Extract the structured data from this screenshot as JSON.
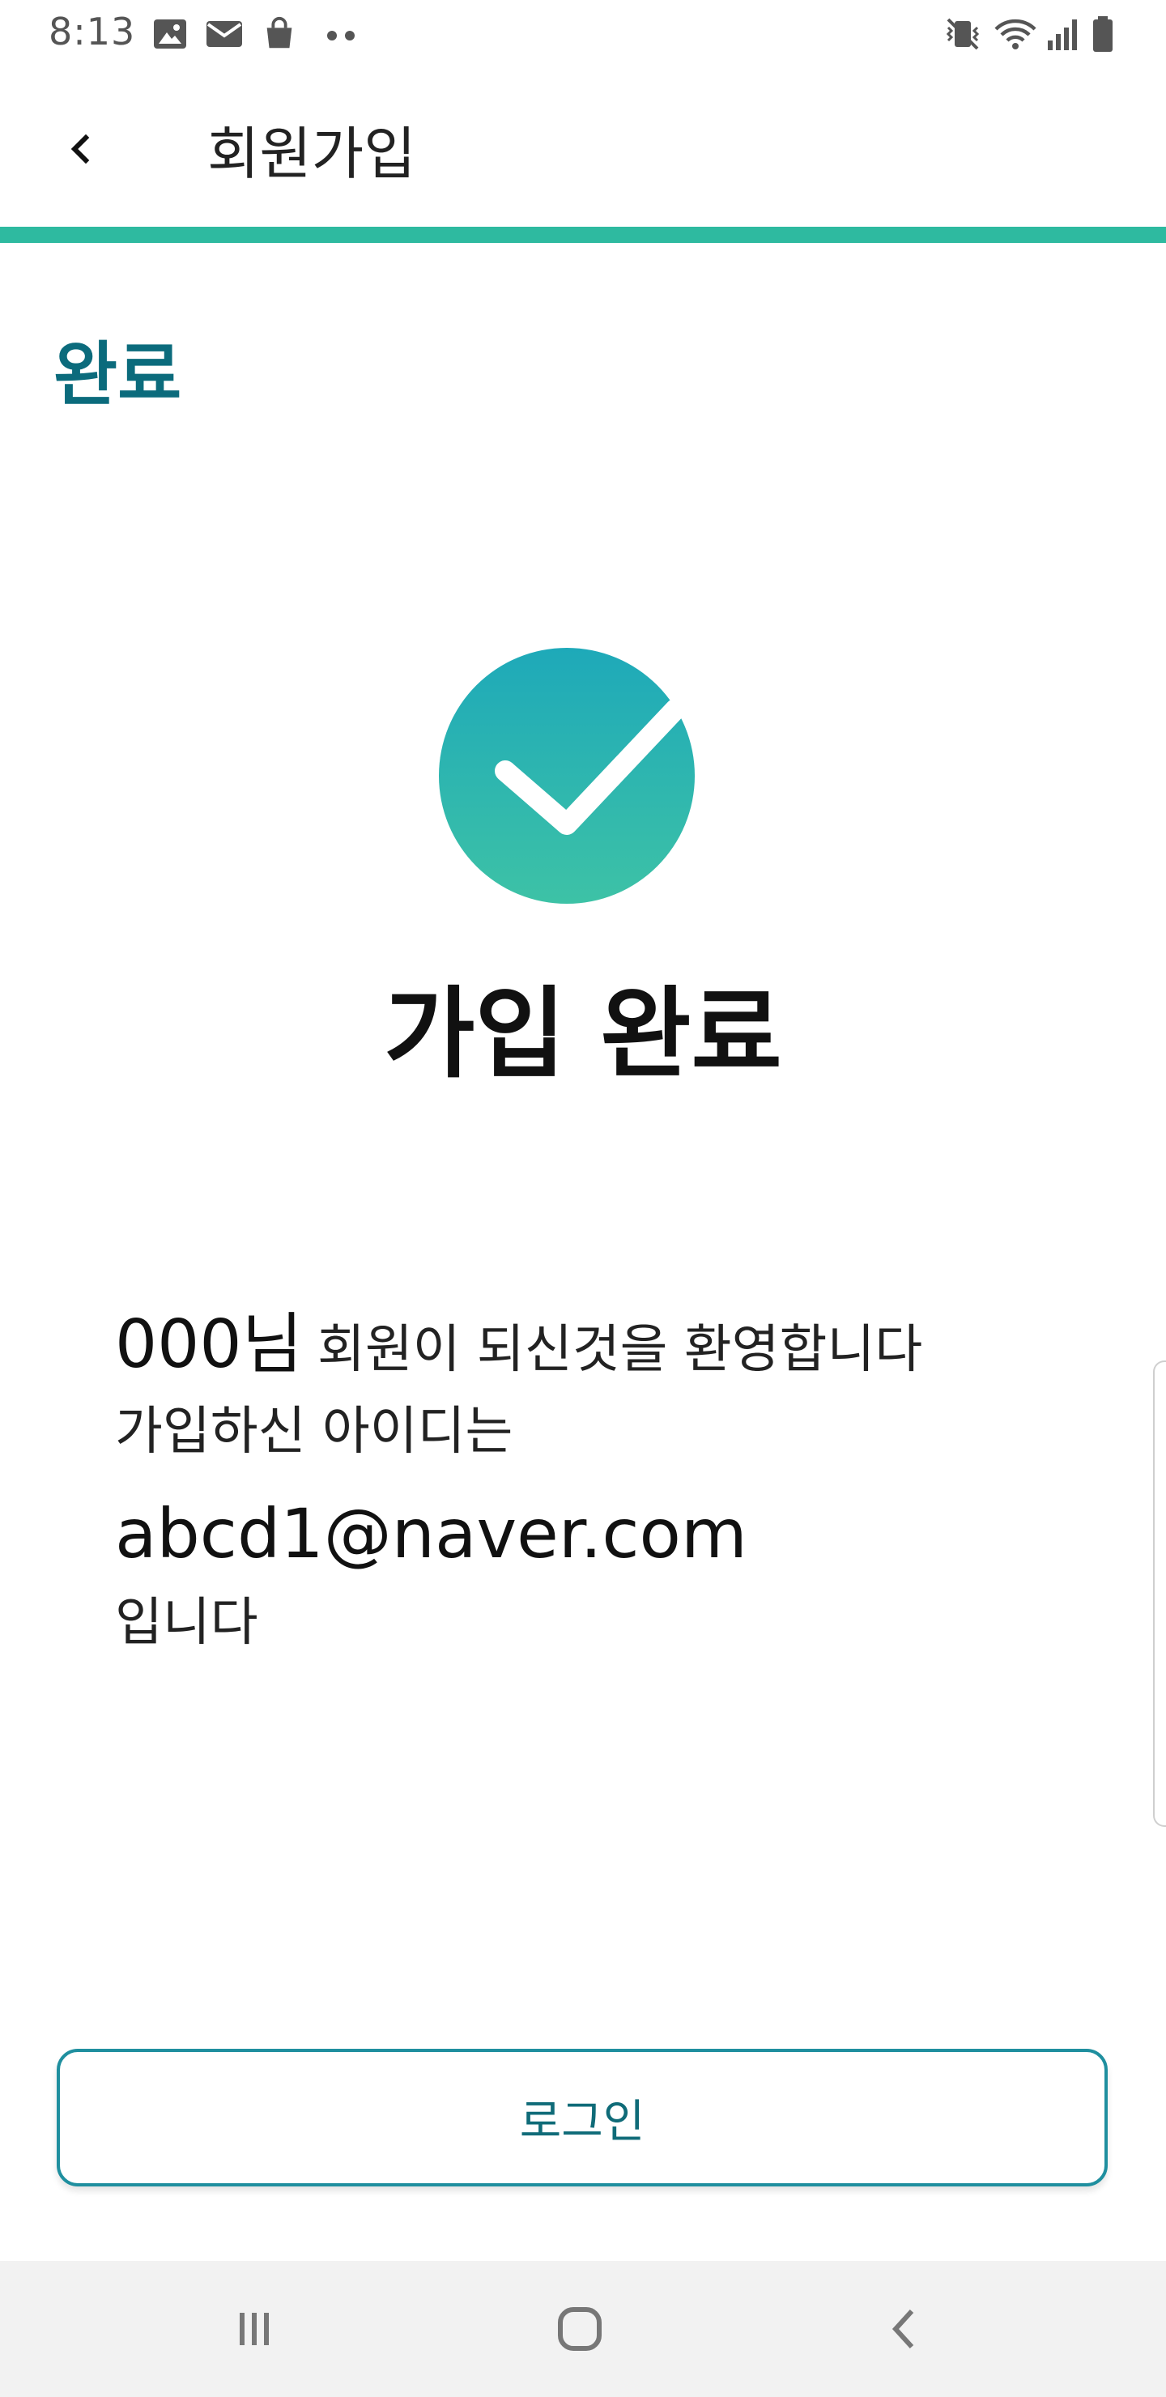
{
  "status_bar": {
    "time": "8:13",
    "left_icons": [
      "image-icon",
      "mail-icon",
      "shopping-bag-icon",
      "more-dots-icon"
    ],
    "right_icons": [
      "vibrate-mute-icon",
      "wifi-icon",
      "signal-icon",
      "battery-icon"
    ]
  },
  "header": {
    "back_icon": "chevron-left-icon",
    "title": "회원가입",
    "progress": 1.0,
    "accent_color": "#2ebaa0"
  },
  "step": {
    "label": "완료",
    "color": "#0b6b7c"
  },
  "result": {
    "icon": "check-circle-icon",
    "title": "가입 완료"
  },
  "message": {
    "name": "000님",
    "welcome": "회원이 되신것을 환영합니다",
    "id_intro": "가입하신 아이디는",
    "email": "abcd1@naver.com",
    "suffix": "입니다"
  },
  "actions": {
    "login_label": "로그인",
    "button_color": "#1f8f9f"
  },
  "nav_bar": {
    "buttons": [
      "recent-apps-icon",
      "home-icon",
      "back-icon"
    ]
  }
}
